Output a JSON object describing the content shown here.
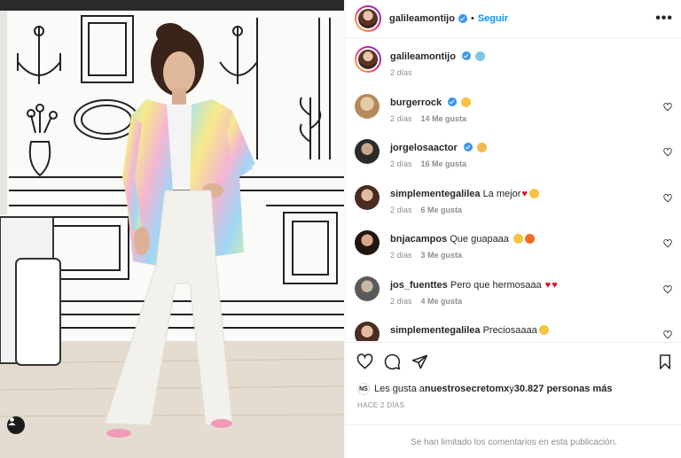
{
  "post": {
    "author": "galileamontijo",
    "follow_label": "Seguir",
    "separator": "•",
    "caption_time": "2 días",
    "more_label": "•••"
  },
  "comments": [
    {
      "user": "burgerrock",
      "text": "",
      "verified": true,
      "emoji": "star-eyes",
      "time": "2 días",
      "likes": "14 Me gusta"
    },
    {
      "user": "jorgelosaactor",
      "text": "",
      "verified": true,
      "emoji": "clap",
      "time": "2 días",
      "likes": "16 Me gusta"
    },
    {
      "user": "simplementegalilea",
      "text": "La mejor",
      "verified": false,
      "emoji": "heart-hands",
      "time": "2 días",
      "likes": "6 Me gusta"
    },
    {
      "user": "bnjacampos",
      "text": "Que guapaaa",
      "verified": false,
      "emoji": "star-fire",
      "time": "2 días",
      "likes": "3 Me gusta"
    },
    {
      "user": "jos_fuenttes",
      "text": "Pero que hermosaaa",
      "verified": false,
      "emoji": "two-hearts",
      "time": "2 días",
      "likes": "4 Me gusta"
    },
    {
      "user": "simplementegalilea",
      "text": "Preciosaaaa",
      "verified": false,
      "emoji": "star-eyes",
      "time": "",
      "likes": ""
    }
  ],
  "likes_summary": {
    "avatar_text": "NS",
    "prefix": "Les gusta a ",
    "first_user": "nuestrosecretomx",
    "middle": " y ",
    "count_text": "30.827 personas más"
  },
  "timestamp": "HACE 2 DÍAS",
  "comments_limited": "Se han limitado los comentarios en esta publicación.",
  "colors": {
    "link_blue": "#0095f6",
    "verified_blue": "#3897f0",
    "muted": "#8e8e8e",
    "heart_red": "#e0102b"
  },
  "icons": [
    "heart-icon",
    "comment-icon",
    "share-icon",
    "bookmark-icon",
    "tag-user-icon",
    "more-options-icon",
    "verified-icon"
  ]
}
